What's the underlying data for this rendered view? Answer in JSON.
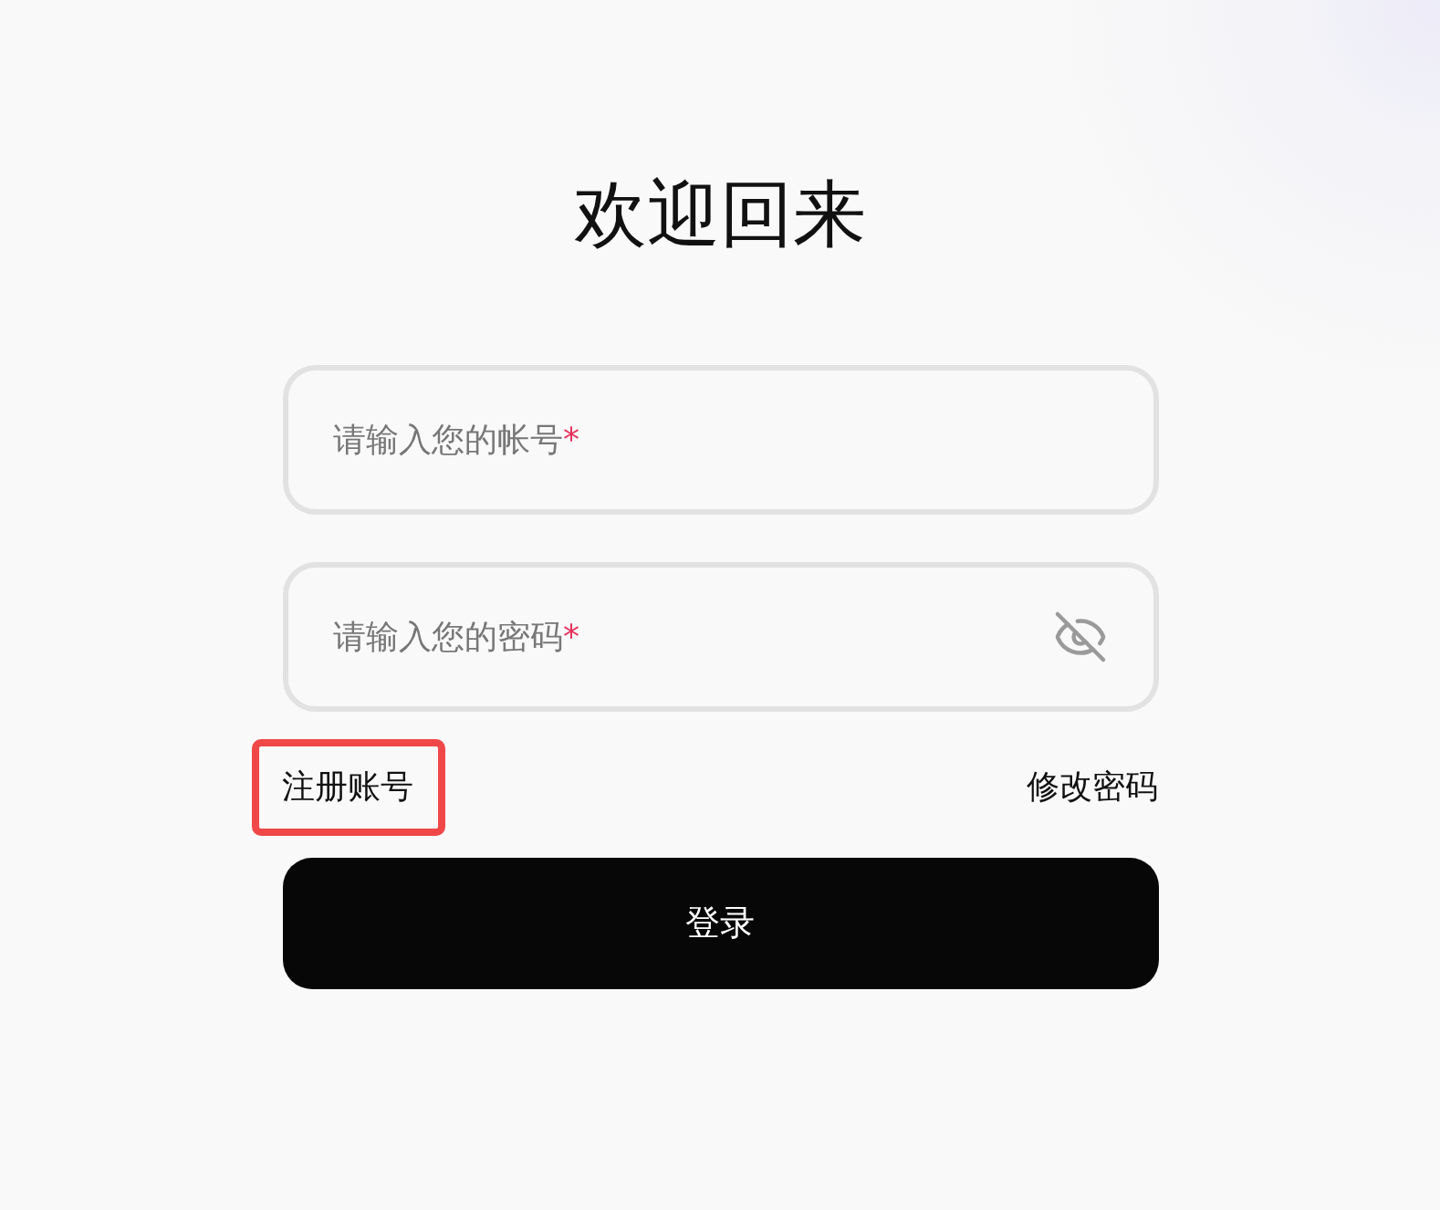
{
  "title": "欢迎回来",
  "fields": [
    {
      "kind": "text",
      "placeholder": "请输入您的帐号",
      "required_mark": "*"
    },
    {
      "kind": "password",
      "placeholder": "请输入您的密码",
      "required_mark": "*"
    }
  ],
  "links": [
    {
      "label": "注册账号",
      "highlighted": true
    },
    {
      "label": "修改密码",
      "highlighted": false
    }
  ],
  "submit": {
    "label": "登录"
  }
}
